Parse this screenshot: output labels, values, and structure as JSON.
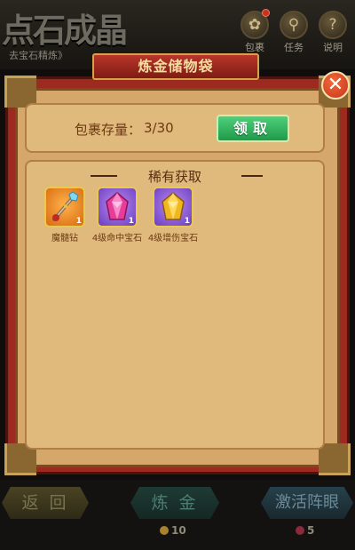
{
  "header": {
    "title": "点石成晶",
    "sub_link": "去宝石精炼》",
    "buttons": [
      {
        "label": "包裹",
        "icon": "bag-icon",
        "has_badge": true
      },
      {
        "label": "任务",
        "icon": "magnifier-icon",
        "has_badge": false
      },
      {
        "label": "说明",
        "icon": "question-icon",
        "has_badge": false
      }
    ]
  },
  "popup": {
    "title": "炼金储物袋",
    "close_symbol": "✕",
    "storage": {
      "label": "包裹存量：",
      "value": "3/30",
      "claim_label": "领取"
    },
    "rare": {
      "title": "稀有获取",
      "items": [
        {
          "name": "魔髓钻",
          "quantity": "1",
          "frame_color": "#d86a10",
          "icon": "scepter-icon"
        },
        {
          "name": "4级命中宝石",
          "quantity": "1",
          "frame_color": "#6b3cc0",
          "icon": "pink-gem-icon"
        },
        {
          "name": "4级增伤宝石",
          "quantity": "1",
          "frame_color": "#6b3cc0",
          "icon": "gold-gem-icon"
        }
      ]
    }
  },
  "bottom": {
    "back_label": "返 回",
    "refine_label": "炼 金",
    "refine_cost": "10",
    "activate_label": "激活阵眼",
    "activate_cost": "5"
  },
  "colors": {
    "popup_frame": "#9c2a1f",
    "parchment": "#d6a76a",
    "text_brown": "#6d3a14",
    "claim_green": "#1f9a4a",
    "close_red": "#c7341a"
  }
}
